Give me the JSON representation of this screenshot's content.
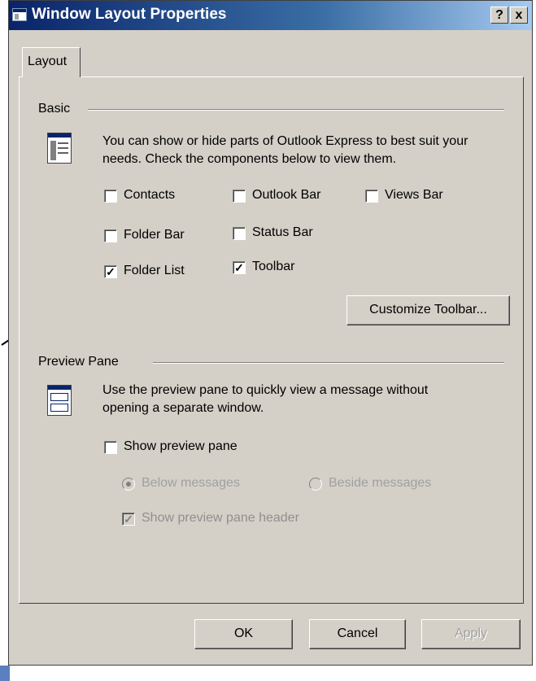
{
  "window": {
    "title": "Window Layout Properties",
    "help_label": "?",
    "close_label": "x"
  },
  "tabs": [
    {
      "label": "Layout",
      "active": true
    }
  ],
  "basic": {
    "heading": "Basic",
    "description": "You can show or hide parts of Outlook Express to best suit your needs.  Check the components below to view them.",
    "options": [
      {
        "label": "Contacts",
        "checked": false
      },
      {
        "label": "Outlook Bar",
        "checked": false
      },
      {
        "label": "Views Bar",
        "checked": false
      },
      {
        "label": "Folder Bar",
        "checked": false
      },
      {
        "label": "Status Bar",
        "checked": false
      },
      {
        "label": "Folder List",
        "checked": true
      },
      {
        "label": "Toolbar",
        "checked": true
      }
    ],
    "customize_label": "Customize Toolbar..."
  },
  "preview": {
    "heading": "Preview Pane",
    "description": "Use the preview pane to quickly view a message without opening a separate window.",
    "show_label": "Show preview pane",
    "show_checked": false,
    "below_label": "Below messages",
    "below_selected": true,
    "beside_label": "Beside messages",
    "beside_selected": false,
    "header_label": "Show preview pane header",
    "header_checked": true
  },
  "buttons": {
    "ok": "OK",
    "cancel": "Cancel",
    "apply": "Apply"
  },
  "colors": {
    "titlebar": "#0a246a",
    "dialog_face": "#d4d0c8"
  },
  "icons": [
    "window-icon",
    "help-icon",
    "close-icon",
    "layout-icon",
    "preview-pane-icon",
    "arrow-annotation"
  ]
}
